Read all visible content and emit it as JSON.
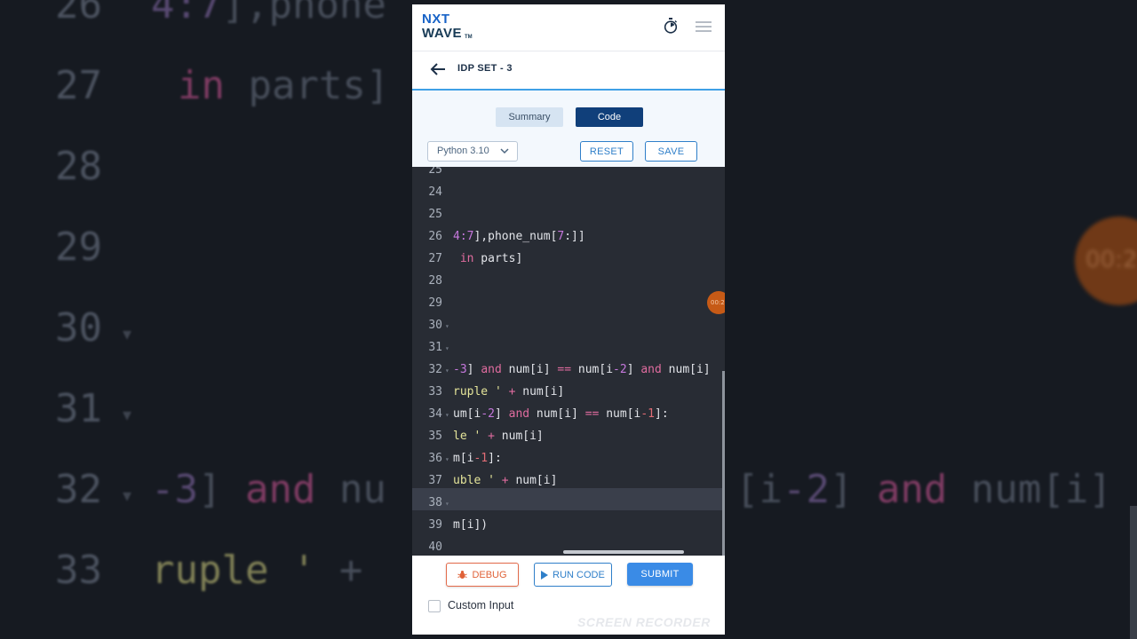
{
  "app": {
    "logo_line1": "NXT",
    "logo_line2": "WAVE",
    "logo_tm": "TM",
    "page_title": "IDP SET - 3"
  },
  "tabs": {
    "summary": "Summary",
    "code": "Code",
    "active": "Code"
  },
  "toolbar": {
    "language": "Python 3.10",
    "reset_label": "RESET",
    "save_label": "SAVE"
  },
  "editor": {
    "timer_badge": "00:2",
    "highlighted_line": "38",
    "lines": [
      {
        "n": "25",
        "segs": []
      },
      {
        "n": "24",
        "segs": []
      },
      {
        "n": "25",
        "segs": []
      },
      {
        "n": "26",
        "segs": [
          {
            "t": "4:7",
            "c": "num"
          },
          {
            "t": "],phone_num[",
            "c": ""
          },
          {
            "t": "7",
            "c": "num"
          },
          {
            "t": ":]]",
            "c": ""
          }
        ]
      },
      {
        "n": "27",
        "segs": [
          {
            "t": " ",
            "c": ""
          },
          {
            "t": "in",
            "c": "kw"
          },
          {
            "t": " parts]",
            "c": ""
          }
        ]
      },
      {
        "n": "28",
        "segs": []
      },
      {
        "n": "29",
        "segs": []
      },
      {
        "n": "30",
        "segs": [],
        "fold": true
      },
      {
        "n": "31",
        "segs": [],
        "fold": true
      },
      {
        "n": "32",
        "segs": [
          {
            "t": "-3",
            "c": "num"
          },
          {
            "t": "] ",
            "c": ""
          },
          {
            "t": "and",
            "c": "kw"
          },
          {
            "t": " num[i] ",
            "c": ""
          },
          {
            "t": "==",
            "c": "kw"
          },
          {
            "t": " num[i",
            "c": ""
          },
          {
            "t": "-2",
            "c": "num"
          },
          {
            "t": "] ",
            "c": ""
          },
          {
            "t": "and",
            "c": "kw"
          },
          {
            "t": " num[i]",
            "c": ""
          }
        ],
        "fold": true
      },
      {
        "n": "33",
        "segs": [
          {
            "t": "ruple '",
            "c": "str"
          },
          {
            "t": " ",
            "c": ""
          },
          {
            "t": "+",
            "c": "kw"
          },
          {
            "t": " num[i]",
            "c": ""
          }
        ]
      },
      {
        "n": "34",
        "segs": [
          {
            "t": "um[i",
            "c": ""
          },
          {
            "t": "-2",
            "c": "num"
          },
          {
            "t": "] ",
            "c": ""
          },
          {
            "t": "and",
            "c": "kw"
          },
          {
            "t": " num[i] ",
            "c": ""
          },
          {
            "t": "==",
            "c": "kw"
          },
          {
            "t": " num[i",
            "c": ""
          },
          {
            "t": "-1",
            "c": "red"
          },
          {
            "t": "]:",
            "c": ""
          }
        ],
        "fold": true
      },
      {
        "n": "35",
        "segs": [
          {
            "t": "le '",
            "c": "str"
          },
          {
            "t": " ",
            "c": ""
          },
          {
            "t": "+",
            "c": "kw"
          },
          {
            "t": " num[i]",
            "c": ""
          }
        ]
      },
      {
        "n": "36",
        "segs": [
          {
            "t": "m[i",
            "c": ""
          },
          {
            "t": "-1",
            "c": "red"
          },
          {
            "t": "]:",
            "c": ""
          }
        ],
        "fold": true
      },
      {
        "n": "37",
        "segs": [
          {
            "t": "uble '",
            "c": "str"
          },
          {
            "t": " ",
            "c": ""
          },
          {
            "t": "+",
            "c": "kw"
          },
          {
            "t": " num[i]",
            "c": ""
          }
        ]
      },
      {
        "n": "38",
        "segs": [],
        "fold": true
      },
      {
        "n": "39",
        "segs": [
          {
            "t": "m[i])",
            "c": ""
          }
        ]
      },
      {
        "n": "40",
        "segs": []
      }
    ]
  },
  "actions": {
    "debug_label": "DEBUG",
    "run_label": "RUN CODE",
    "submit_label": "SUBMIT",
    "custom_input_label": "Custom Input",
    "custom_input_checked": false
  },
  "overlay": {
    "watermark": "SCREEN RECORDER"
  },
  "background_zoom": {
    "timer": "00:2",
    "lines": [
      {
        "n": "26",
        "text": [
          {
            "t": "4:7",
            "c": "mag"
          },
          {
            "t": "],phone",
            "c": ""
          }
        ]
      },
      {
        "n": "27",
        "text": [
          {
            "t": "in",
            "c": "kw"
          },
          {
            "t": " parts]",
            "c": ""
          }
        ]
      },
      {
        "n": "28",
        "text": []
      },
      {
        "n": "29",
        "text": []
      },
      {
        "n": "30",
        "text": []
      },
      {
        "n": "31",
        "text": []
      },
      {
        "n": "32",
        "text": [
          {
            "t": "-3",
            "c": "mag"
          },
          {
            "t": "] ",
            "c": ""
          },
          {
            "t": "and",
            "c": "kw"
          },
          {
            "t": " nu",
            "c": ""
          }
        ]
      },
      {
        "n": "33",
        "text": [
          {
            "t": "ruple '",
            "c": "str"
          },
          {
            "t": " +",
            "c": ""
          }
        ]
      }
    ],
    "right_text": [
      {
        "t": "[i",
        "c": ""
      },
      {
        "t": "-2",
        "c": "mag"
      },
      {
        "t": "] ",
        "c": ""
      },
      {
        "t": "and",
        "c": "kw"
      },
      {
        "t": " num[i]",
        "c": ""
      }
    ]
  },
  "colors": {
    "brand_blue": "#1863c7",
    "code_tab_bg": "#103f7a",
    "submit_bg": "#3a8be6",
    "debug_accent": "#e06238",
    "editor_bg": "#282c34"
  }
}
